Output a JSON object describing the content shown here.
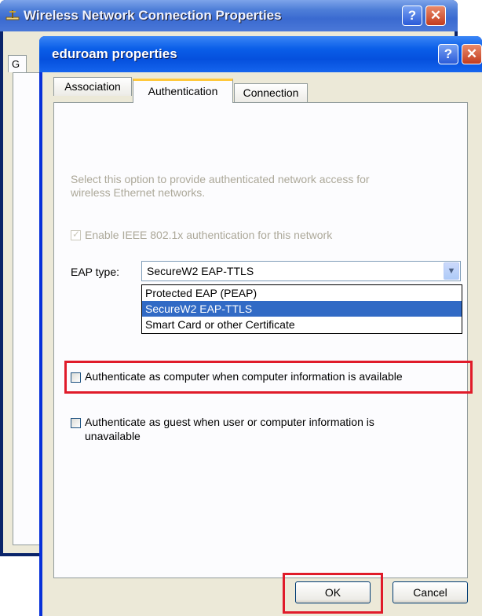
{
  "back_window": {
    "title": "Wireless Network Connection Properties",
    "tab_fragment": "G",
    "help_label": "?",
    "close_label": "✕"
  },
  "dialog": {
    "title": "eduroam properties",
    "help_label": "?",
    "close_label": "✕",
    "tabs": [
      {
        "label": "Association",
        "active": false
      },
      {
        "label": "Authentication",
        "active": true
      },
      {
        "label": "Connection",
        "active": false
      }
    ],
    "description_line1": "Select this option to provide authenticated network access for",
    "description_line2": "wireless Ethernet networks.",
    "enable_8021x": {
      "label": "Enable IEEE 802.1x authentication for this network",
      "checked": true,
      "disabled": true
    },
    "eap_type": {
      "label": "EAP type:",
      "selected": "SecureW2 EAP-TTLS",
      "options": [
        "Protected EAP (PEAP)",
        "SecureW2 EAP-TTLS",
        "Smart Card or other Certificate"
      ]
    },
    "auth_computer": {
      "label": "Authenticate as computer when computer information is available",
      "checked": false
    },
    "auth_guest": {
      "line1": "Authenticate as guest when user or computer information is",
      "line2": "unavailable",
      "checked": false
    },
    "ok_label": "OK",
    "cancel_label": "Cancel"
  },
  "colors": {
    "highlight_box": "#e01b2a",
    "selection": "#316ac5",
    "title_bar": "#0a5ee8"
  }
}
